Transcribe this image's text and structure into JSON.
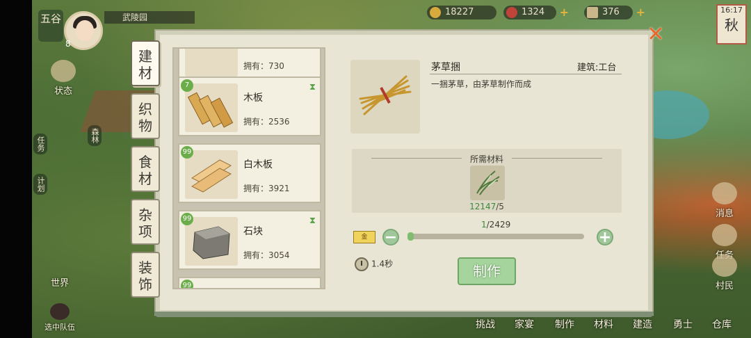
{
  "hud": {
    "season_badge": "五谷",
    "level": "8",
    "place": "武陵园",
    "coins": "18227",
    "gems": "1324",
    "tickets": "376",
    "time": "16:17",
    "season": "秋",
    "left_labels": [
      "状态",
      "任务",
      "计划",
      "世界",
      "选中队伍"
    ],
    "forest_tag": "森林",
    "right_labels": [
      "消息",
      "任务",
      "村民"
    ]
  },
  "bottom_menu": [
    "挑战",
    "家宴",
    "制作",
    "材料",
    "建造",
    "勇士",
    "仓库"
  ],
  "tabs": [
    "建材",
    "织物",
    "食材",
    "杂项",
    "装饰"
  ],
  "active_tab": "建材",
  "list": {
    "top_partial_own": "拥有：730",
    "cards": [
      {
        "badge": "7",
        "name": "木板",
        "own": "拥有：2536",
        "timer_icon": "hourglass-icon"
      },
      {
        "badge": "99",
        "name": "白木板",
        "own": "拥有：3921",
        "timer_icon": ""
      },
      {
        "badge": "99",
        "name": "石块",
        "own": "拥有：3054",
        "timer_icon": "hourglass-icon"
      }
    ],
    "bottom_partial_badge": "99"
  },
  "detail": {
    "name": "茅草捆",
    "building": "建筑:工台",
    "description": "一捆茅草，由茅草制作而成",
    "required_title": "所需材料",
    "material_have": "12147",
    "material_need": "/5",
    "gold_label": "金",
    "qty_current": "1",
    "qty_max": "/2429",
    "qty_fraction": 0.0004,
    "time": "1.4秒",
    "make_button": "制作"
  },
  "colors": {
    "accent_green": "#7fbc6f",
    "close_orange": "#e8672a",
    "panel": "#e9e5d4"
  }
}
